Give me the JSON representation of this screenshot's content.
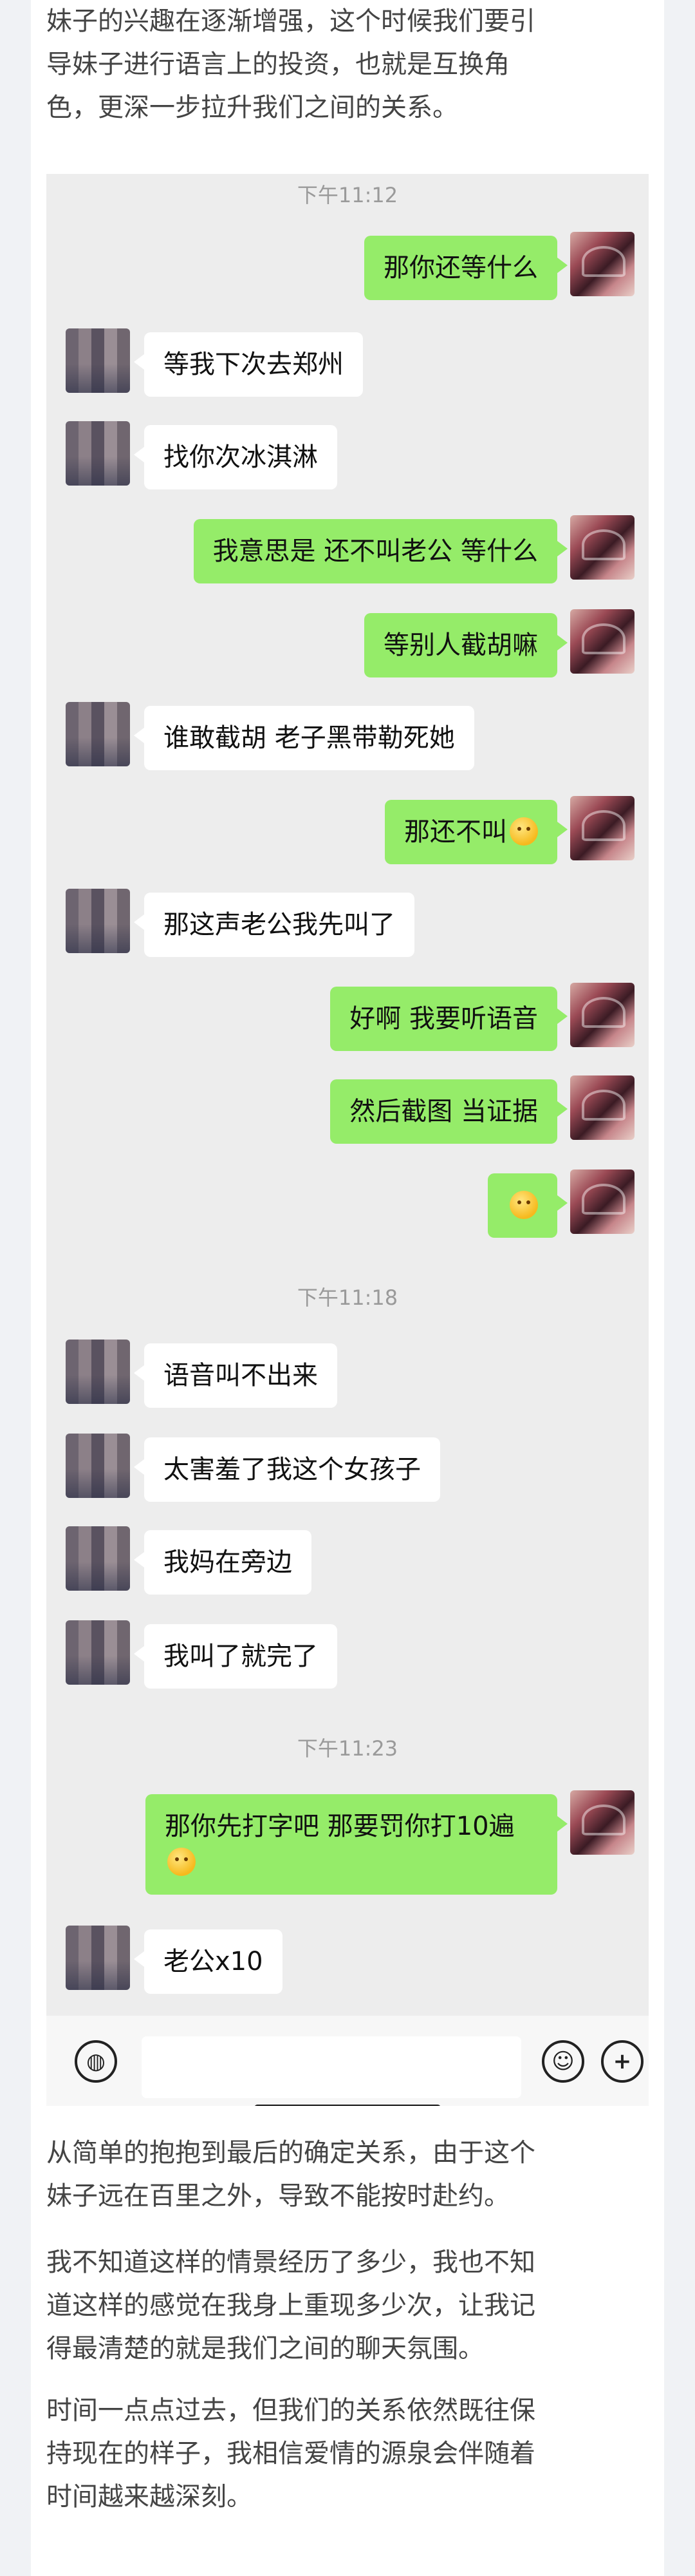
{
  "intro_text": "妹子的兴趣在逐渐增强，这个时候我们要引\n导妹子进行语言上的投资，也就是互换角\n色，更深一步拉升我们之间的关系。",
  "chat": {
    "timestamps": [
      "下午11:12",
      "下午11:18",
      "下午11:23"
    ],
    "messages": [
      {
        "from": "self",
        "text": "那你还等什么"
      },
      {
        "from": "other",
        "text": "等我下次去郑州"
      },
      {
        "from": "other",
        "text": "找你次冰淇淋"
      },
      {
        "from": "self",
        "text": "我意思是 还不叫老公 等什么"
      },
      {
        "from": "self",
        "text": "等别人截胡嘛"
      },
      {
        "from": "other",
        "text": "谁敢截胡 老子黑带勒死她"
      },
      {
        "from": "self",
        "text": "那还不叫",
        "emoji": "wink-emoji"
      },
      {
        "from": "other",
        "text": "那这声老公我先叫了"
      },
      {
        "from": "self",
        "text": "好啊 我要听语音"
      },
      {
        "from": "self",
        "text": "然后截图 当证据"
      },
      {
        "from": "self",
        "text": "",
        "emoji": "grin-emoji"
      },
      {
        "from": "other",
        "text": "语音叫不出来"
      },
      {
        "from": "other",
        "text": "太害羞了我这个女孩子"
      },
      {
        "from": "other",
        "text": "我妈在旁边"
      },
      {
        "from": "other",
        "text": "我叫了就完了"
      },
      {
        "from": "self",
        "text": "那你先打字吧 那要罚你打10遍",
        "emoji": "smirk-emoji"
      },
      {
        "from": "other",
        "text": "老公x10"
      }
    ],
    "toolbar": {
      "voice_icon": "voice-icon",
      "input_value": "",
      "emoji_icon": "emoji-icon",
      "plus_icon": "plus-icon"
    }
  },
  "outro_paragraphs": [
    "从简单的抱抱到最后的确定关系，由于这个\n妹子远在百里之外，导致不能按时赴约。",
    "我不知道这样的情景经历了多少，我也不知\n道这样的感觉在我身上重现多少次，让我记\n得最清楚的就是我们之间的聊天氛围。",
    "时间一点点过去，但我们的关系依然既往保\n持现在的样子，我相信爱情的源泉会伴随着\n时间越来越深刻。"
  ],
  "colors": {
    "self_bubble": "#95ec69",
    "other_bubble": "#ffffff",
    "chat_background": "#ededed"
  }
}
